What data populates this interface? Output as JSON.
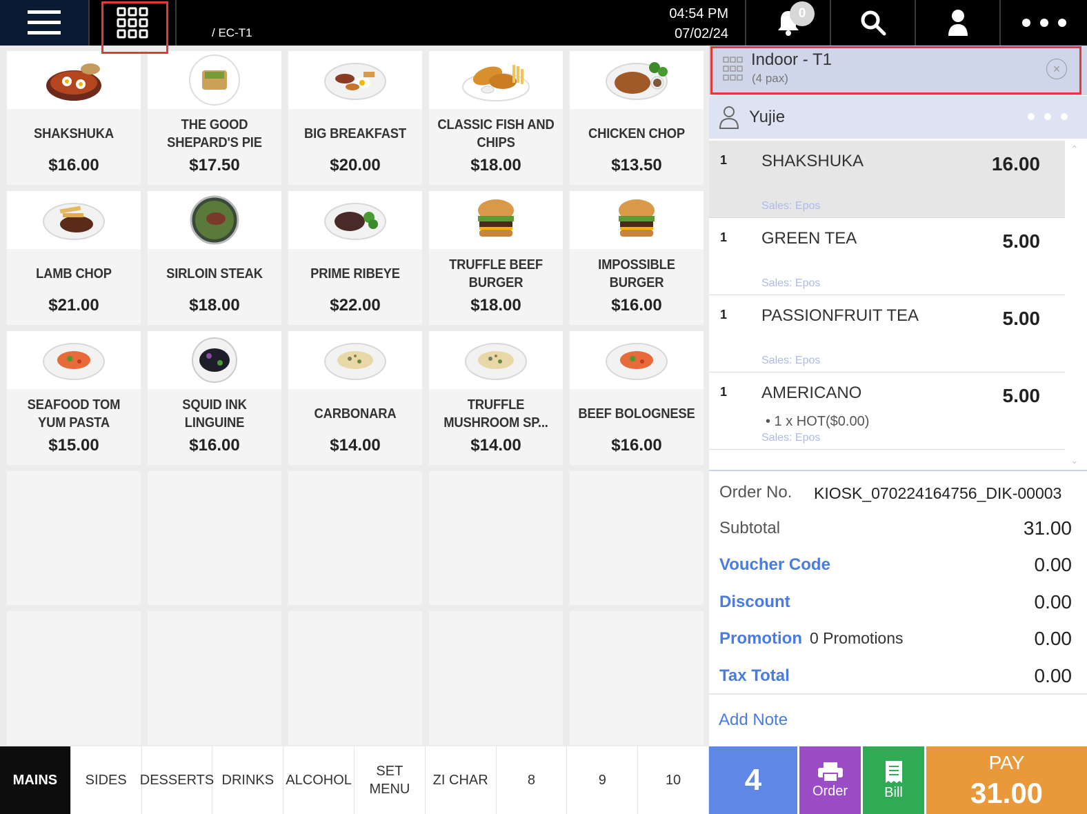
{
  "topbar": {
    "breadcrumb": "/ EC-T1",
    "time": "04:54 PM",
    "date": "07/02/24",
    "notification_count": "0",
    "icons": [
      "hamburger-icon",
      "grid-icon",
      "bell-icon",
      "search-icon",
      "user-icon",
      "more-icon"
    ]
  },
  "products": [
    {
      "name": "SHAKSHUKA",
      "price": "$16.00",
      "img": "skillet-eggs"
    },
    {
      "name": "THE GOOD SHEPARD'S PIE",
      "price": "$17.50",
      "img": "pie"
    },
    {
      "name": "BIG BREAKFAST",
      "price": "$20.00",
      "img": "breakfast"
    },
    {
      "name": "CLASSIC FISH AND CHIPS",
      "price": "$18.00",
      "img": "fish-chips"
    },
    {
      "name": "CHICKEN CHOP",
      "price": "$13.50",
      "img": "chicken"
    },
    {
      "name": "LAMB CHOP",
      "price": "$21.00",
      "img": "lamb"
    },
    {
      "name": "SIRLOIN STEAK",
      "price": "$18.00",
      "img": "steak-bowl"
    },
    {
      "name": "PRIME RIBEYE",
      "price": "$22.00",
      "img": "ribeye"
    },
    {
      "name": "TRUFFLE BEEF BURGER",
      "price": "$18.00",
      "img": "burger"
    },
    {
      "name": "IMPOSSIBLE BURGER",
      "price": "$16.00",
      "img": "burger"
    },
    {
      "name": "SEAFOOD TOM YUM PASTA",
      "price": "$15.00",
      "img": "pasta-red"
    },
    {
      "name": "SQUID INK LINGUINE",
      "price": "$16.00",
      "img": "pasta-black"
    },
    {
      "name": "CARBONARA",
      "price": "$14.00",
      "img": "pasta-cream"
    },
    {
      "name": "TRUFFLE MUSHROOM SP...",
      "price": "$14.00",
      "img": "pasta-cream"
    },
    {
      "name": "BEEF BOLOGNESE",
      "price": "$16.00",
      "img": "pasta-red"
    }
  ],
  "tabs": [
    {
      "label": "MAINS",
      "active": true
    },
    {
      "label": "SIDES"
    },
    {
      "label": "DESSERTS"
    },
    {
      "label": "DRINKS"
    },
    {
      "label": "ALCOHOL"
    },
    {
      "label": "SET MENU"
    },
    {
      "label": "ZI CHAR"
    },
    {
      "label": "8"
    },
    {
      "label": "9"
    },
    {
      "label": "10"
    }
  ],
  "order_panel": {
    "table_name": "Indoor - T1",
    "pax": "(4 pax)",
    "customer": "Yujie",
    "lines": [
      {
        "qty": "1",
        "name": "SHAKSHUKA",
        "price": "16.00",
        "modifier": "",
        "sales": "Sales: Epos",
        "selected": true
      },
      {
        "qty": "1",
        "name": "GREEN TEA",
        "price": "5.00",
        "modifier": "",
        "sales": "Sales: Epos"
      },
      {
        "qty": "1",
        "name": "PASSIONFRUIT TEA",
        "price": "5.00",
        "modifier": "",
        "sales": "Sales: Epos"
      },
      {
        "qty": "1",
        "name": "AMERICANO",
        "price": "5.00",
        "modifier": "• 1 x HOT($0.00)",
        "sales": "Sales: Epos"
      }
    ],
    "summary": {
      "order_no_label": "Order No.",
      "order_no": "KIOSK_070224164756_DIK-00003",
      "subtotal_label": "Subtotal",
      "subtotal": "31.00",
      "voucher_label": "Voucher Code",
      "voucher": "0.00",
      "discount_label": "Discount",
      "discount": "0.00",
      "promotion_label": "Promotion",
      "promotion_count": "0 Promotions",
      "promotion": "0.00",
      "tax_label": "Tax Total",
      "tax": "0.00",
      "add_note": "Add Note"
    }
  },
  "actions": {
    "seat_count": "4",
    "order_label": "Order",
    "bill_label": "Bill",
    "pay_label": "PAY",
    "pay_amount": "31.00"
  },
  "colors": {
    "accent_blue": "#5e87e6",
    "order_purple": "#9b4dc6",
    "bill_green": "#2faa55",
    "pay_orange": "#e9983a",
    "highlight_red": "#e53935",
    "link_blue": "#4a7be0"
  }
}
